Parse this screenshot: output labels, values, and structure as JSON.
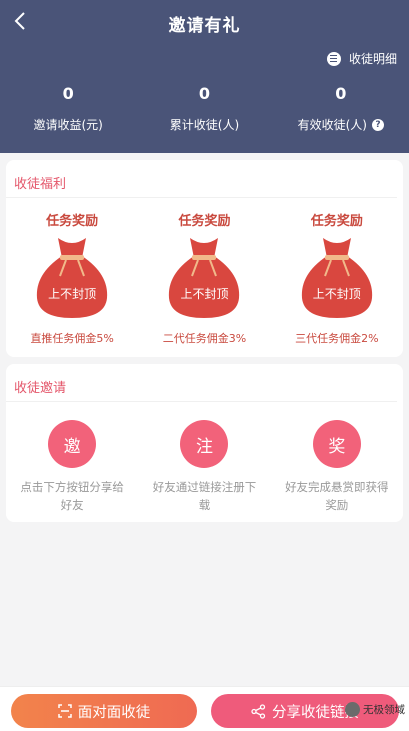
{
  "header": {
    "title": "邀请有礼",
    "detail_label": "收徒明细",
    "stats": [
      {
        "value": "0",
        "label": "邀请收益(元)"
      },
      {
        "value": "0",
        "label": "累计收徒(人)"
      },
      {
        "value": "0",
        "label": "有效收徒(人)"
      }
    ]
  },
  "benefits": {
    "title": "收徒福利",
    "rewards": [
      {
        "title": "任务奖励",
        "bag_text": "上不封顶",
        "note": "直推任务佣金5%"
      },
      {
        "title": "任务奖励",
        "bag_text": "上不封顶",
        "note": "二代任务佣金3%"
      },
      {
        "title": "任务奖励",
        "bag_text": "上不封顶",
        "note": "三代任务佣金2%"
      }
    ]
  },
  "invite": {
    "title": "收徒邀请",
    "steps": [
      {
        "char": "邀",
        "text": "点击下方按钮分享给好友"
      },
      {
        "char": "注",
        "text": "好友通过链接注册下载"
      },
      {
        "char": "奖",
        "text": "好友完成悬赏即获得奖励"
      }
    ]
  },
  "footer": {
    "face_label": "面对面收徒",
    "share_label": "分享收徒链接",
    "watermark": "无极领域"
  },
  "colors": {
    "header_bg": "#4a5478",
    "accent_pink": "#e4576b",
    "bag_red": "#d9473f",
    "step_circle": "#f2627a",
    "btn_orange": "#f07a4e",
    "btn_pink": "#ef5b7b"
  }
}
